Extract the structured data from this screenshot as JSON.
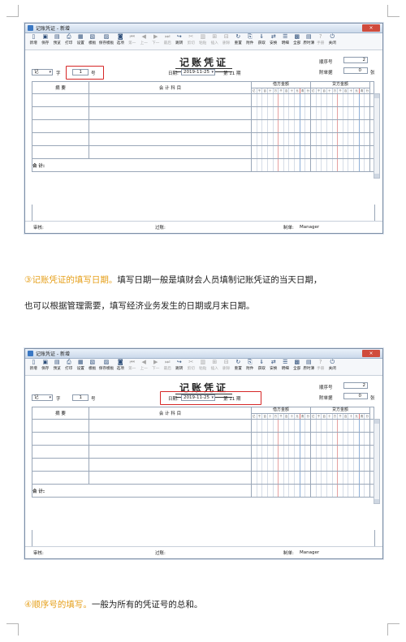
{
  "window": {
    "title": "记账凭证 - 新增",
    "close_label": "×"
  },
  "toolbar": [
    {
      "label": "新增",
      "icon": "new-doc-icon",
      "glyph": "▯",
      "enabled": true
    },
    {
      "label": "保存",
      "icon": "save-icon",
      "glyph": "▣",
      "enabled": true
    },
    {
      "label": "预览",
      "icon": "preview-icon",
      "glyph": "▤",
      "enabled": true
    },
    {
      "label": "打印",
      "icon": "print-icon",
      "glyph": "⎙",
      "enabled": true
    },
    {
      "label": "设置",
      "icon": "settings-icon",
      "glyph": "▦",
      "enabled": true
    },
    {
      "label": "模板",
      "icon": "template-icon",
      "glyph": "▧",
      "enabled": true
    },
    {
      "label": "保存模板",
      "icon": "save-template-icon",
      "glyph": "▨",
      "enabled": true,
      "wide": true
    },
    {
      "label": "选项",
      "icon": "options-icon",
      "glyph": "◙",
      "enabled": true
    },
    {
      "label": "第一",
      "icon": "first-icon",
      "glyph": "⏮",
      "enabled": false
    },
    {
      "label": "上一",
      "icon": "prev-icon",
      "glyph": "◀",
      "enabled": false
    },
    {
      "label": "下一",
      "icon": "next-icon",
      "glyph": "▶",
      "enabled": false
    },
    {
      "label": "最后",
      "icon": "last-icon",
      "glyph": "⏭",
      "enabled": false
    },
    {
      "label": "跳转",
      "icon": "jump-icon",
      "glyph": "↪",
      "enabled": true
    },
    {
      "label": "剪切",
      "icon": "cut-icon",
      "glyph": "✂",
      "enabled": false
    },
    {
      "label": "粘贴",
      "icon": "paste-icon",
      "glyph": "▥",
      "enabled": false
    },
    {
      "label": "插入",
      "icon": "insert-icon",
      "glyph": "⊞",
      "enabled": false
    },
    {
      "label": "删除",
      "icon": "delete-icon",
      "glyph": "⊟",
      "enabled": false
    },
    {
      "label": "重置",
      "icon": "reset-icon",
      "glyph": "↻",
      "enabled": true
    },
    {
      "label": "附件",
      "icon": "attachment-icon",
      "glyph": "⎘",
      "enabled": true
    },
    {
      "label": "获取",
      "icon": "fetch-icon",
      "glyph": "⇓",
      "enabled": true
    },
    {
      "label": "安换",
      "icon": "swap-icon",
      "glyph": "⇄",
      "enabled": true
    },
    {
      "label": "明细",
      "icon": "detail-icon",
      "glyph": "☰",
      "enabled": true
    },
    {
      "label": "全部",
      "icon": "all-icon",
      "glyph": "▩",
      "enabled": true
    },
    {
      "label": "原时薄",
      "icon": "ledger-icon",
      "glyph": "▤",
      "enabled": true
    },
    {
      "label": "手册",
      "icon": "manual-icon",
      "glyph": "?",
      "enabled": false
    },
    {
      "label": "关闭",
      "icon": "exit-icon",
      "glyph": "⏻",
      "enabled": true
    }
  ],
  "voucher": {
    "title": "记账凭证",
    "seq_label": "顺序号",
    "seq_value": "2",
    "attachments_label": "附单据",
    "attachments_value": "0",
    "attachments_unit": "张",
    "type_value": "记",
    "zi_label": "字",
    "number_value": "1",
    "number_unit": "号",
    "date_label": "日期:",
    "date_value": "2019-11-25",
    "period_text": "第 11 期",
    "col_summary": "摘    要",
    "col_account": "会 计 科 目",
    "col_debit": "借方金额",
    "col_credit": "贷方金额",
    "digit_units": [
      "亿",
      "千",
      "百",
      "十",
      "万",
      "千",
      "百",
      "十",
      "元",
      "角",
      "分"
    ],
    "total_label": "合  计:",
    "auditor_label": "审核:",
    "poster_label": "过账:",
    "maker_label": "制单:",
    "maker_value": "Manager"
  },
  "paragraphs": {
    "p3_head": "③记账凭证的填写日期。",
    "p3_body": "填写日期一般是填财会人员填制记账凭证的当天日期，",
    "p3_line2": "也可以根据管理需要，填写经济业务发生的日期或月末日期。",
    "p4_head": "④顺序号的填写。",
    "p4_body": "一般为所有的凭证号的总和。"
  }
}
